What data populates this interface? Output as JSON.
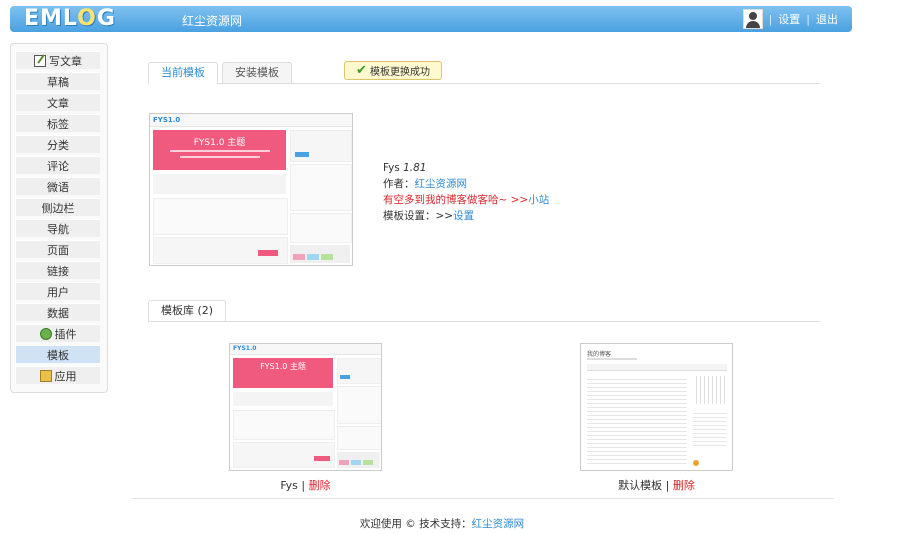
{
  "header": {
    "logo_text": "EMLOG",
    "site_name": "红尘资源网",
    "settings_label": "设置",
    "logout_label": "退出",
    "separator": "|"
  },
  "sidebar": {
    "items": [
      {
        "label": "写文章",
        "icon": "write-icon"
      },
      {
        "label": "草稿"
      },
      {
        "label": "文章"
      },
      {
        "label": "标签"
      },
      {
        "label": "分类"
      },
      {
        "label": "评论"
      },
      {
        "label": "微语"
      },
      {
        "label": "侧边栏"
      },
      {
        "label": "导航"
      },
      {
        "label": "页面"
      },
      {
        "label": "链接"
      },
      {
        "label": "用户"
      },
      {
        "label": "数据"
      },
      {
        "label": "插件",
        "icon": "plugin-icon"
      },
      {
        "label": "模板",
        "active": true
      },
      {
        "label": "应用",
        "icon": "app-icon"
      }
    ]
  },
  "tabs": {
    "current": "当前模板",
    "install": "安装模板"
  },
  "toast": {
    "message": "模板更换成功"
  },
  "current_template": {
    "name": "Fys",
    "version": "1.81",
    "author_label": "作者：",
    "author_name": "红尘资源网",
    "description": "有空多到我的博客做客哈~ >>",
    "description_link": "小站",
    "settings_label": "模板设置：>>",
    "settings_link": "设置",
    "preview_banner": "FYS1.0 主题"
  },
  "library": {
    "tab_label": "模板库 (2)",
    "templates": [
      {
        "name": "Fys",
        "separator": "|",
        "delete_label": "删除",
        "banner": "FYS1.0 主题"
      },
      {
        "name": "默认模板",
        "separator": "|",
        "delete_label": "删除",
        "banner": "我的博客"
      }
    ]
  },
  "footer": {
    "text": "欢迎使用 © 技术支持：",
    "link": "红尘资源网"
  },
  "colors": {
    "header_blue": "#4aa1e0",
    "link_blue": "#2d8bd6",
    "alert_red": "#d9252b",
    "banner_pink": "#f05a7e"
  }
}
